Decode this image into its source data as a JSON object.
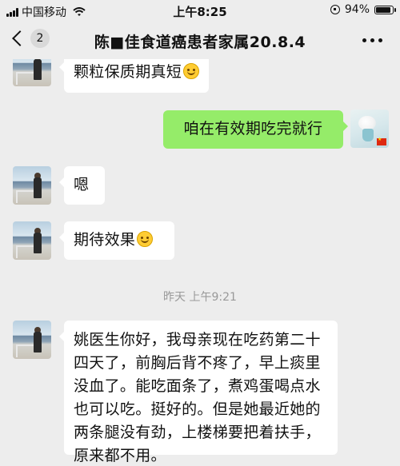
{
  "status_bar": {
    "carrier": "中国移动",
    "time": "上午8:25",
    "battery": "94%",
    "battery_level": 0.94
  },
  "nav": {
    "unread_count": "2",
    "title": "陈■佳食道癌患者家属20.8.4"
  },
  "messages": [
    {
      "side": "left",
      "text": "颗粒保质期真短",
      "emoji": "smile-emoji"
    },
    {
      "side": "right",
      "text": "咱在有效期吃完就行"
    },
    {
      "side": "left",
      "text": "嗯"
    },
    {
      "side": "left",
      "text": "期待效果",
      "emoji": "smile-emoji"
    },
    {
      "side": "left",
      "text": "姚医生你好，我母亲现在吃药第二十四天了，前胸后背不疼了，早上痰里没血了。能吃面条了，煮鸡蛋喝点水也可以吃。挺好的。但是她最近她的两条腿没有劲，上楼梯要把着扶手，原来都不用。"
    }
  ],
  "timestamp": "昨天 上午9:21",
  "icons": [
    "back-chevron-icon",
    "more-icon",
    "signal-icon",
    "wifi-icon",
    "rotation-lock-icon",
    "battery-icon"
  ],
  "colors": {
    "background": "#ededed",
    "bubble_in": "#ffffff",
    "bubble_out": "#95ec69",
    "timestamp": "#999999"
  }
}
